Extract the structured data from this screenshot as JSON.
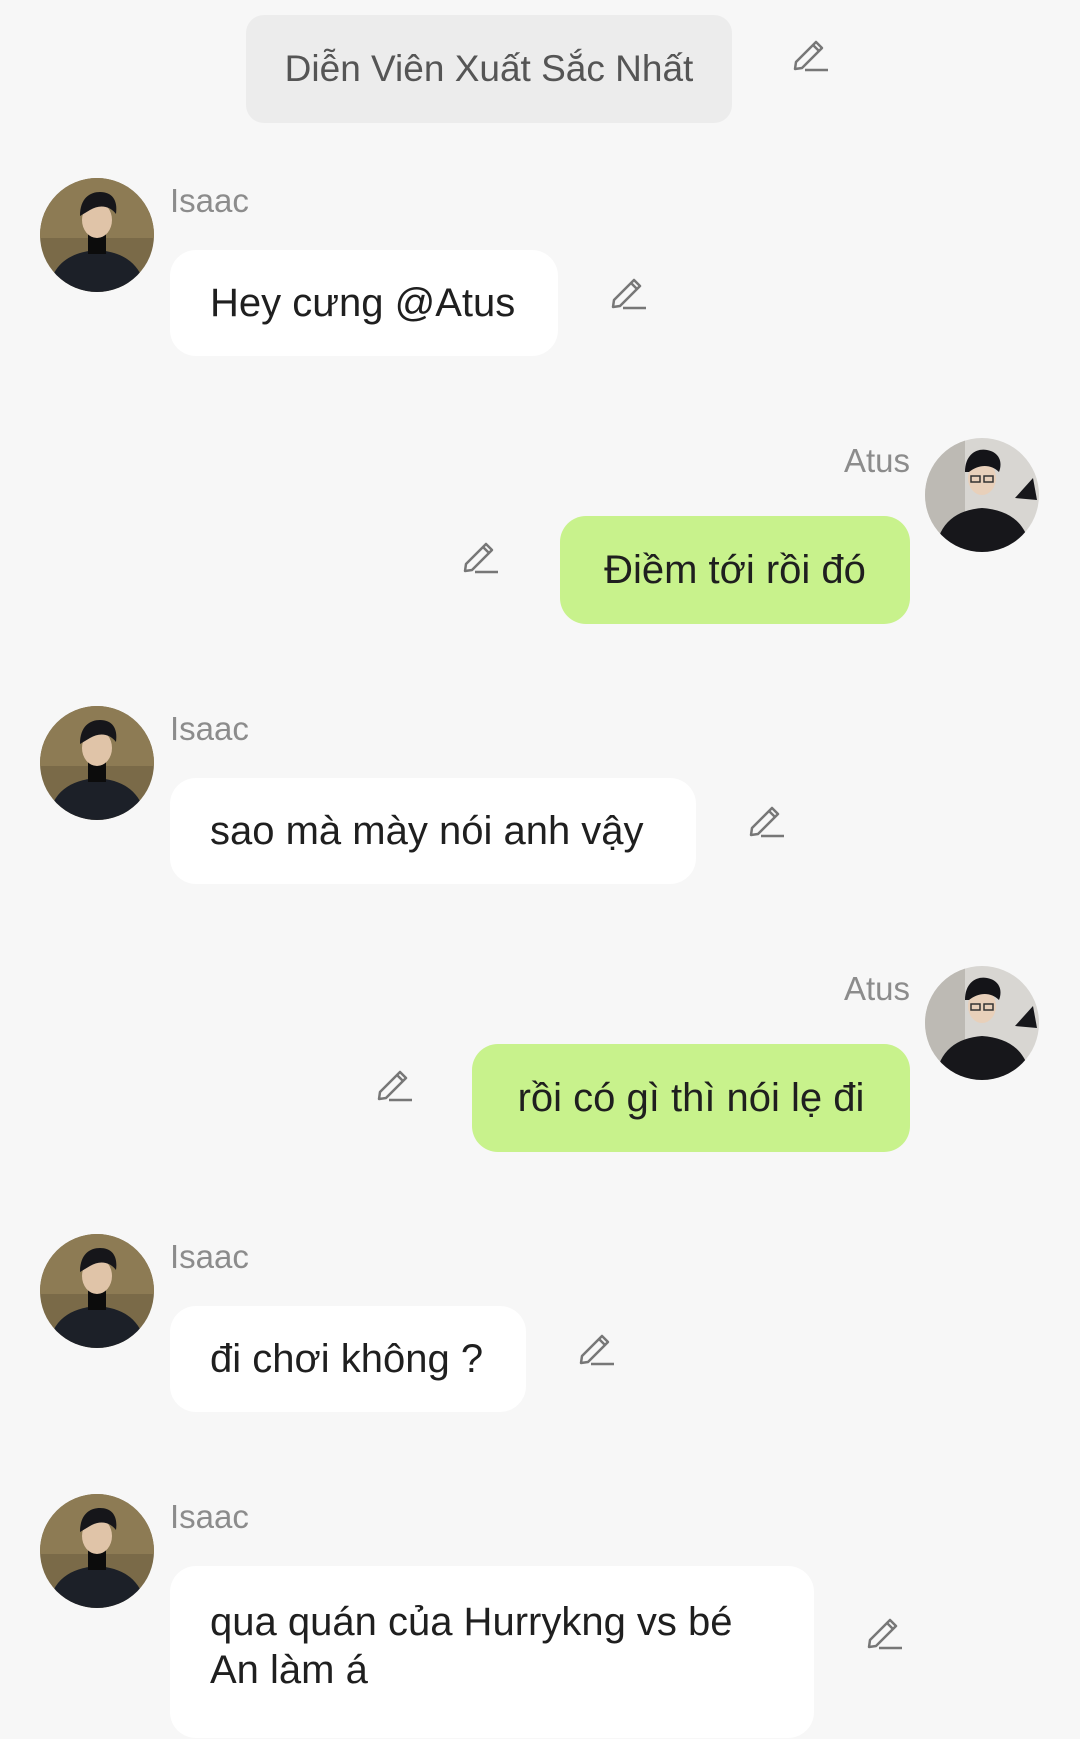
{
  "chat": {
    "topic": "Diễn Viên Xuất Sắc Nhất",
    "messages": [
      {
        "sender": "Isaac",
        "text": "Hey cưng @Atus",
        "side": "left"
      },
      {
        "sender": "Atus",
        "text": "Điềm tới rồi đó",
        "side": "right"
      },
      {
        "sender": "Isaac",
        "text": "sao mà mày nói anh vậy",
        "side": "left"
      },
      {
        "sender": "Atus",
        "text": "rồi có gì thì nói lẹ đi",
        "side": "right"
      },
      {
        "sender": "Isaac",
        "text": "đi chơi không ?",
        "side": "left"
      },
      {
        "sender": "Isaac",
        "text": "qua quán của Hurrykng vs bé An làm á",
        "side": "left"
      }
    ]
  },
  "icons": {
    "edit": "pencil-edit-icon",
    "avatar_isaac": "avatar-isaac",
    "avatar_atus": "avatar-atus"
  },
  "colors": {
    "background": "#f7f7f7",
    "topic_pill": "#ececec",
    "left_bubble": "#ffffff",
    "right_bubble": "#c8f28c",
    "sender_name": "#8c8c8c"
  }
}
